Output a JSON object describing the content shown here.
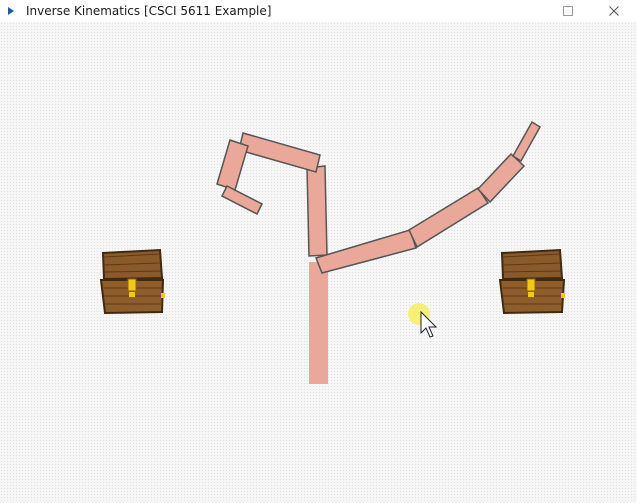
{
  "window": {
    "title": "Inverse Kinematics [CSCI 5611 Example]",
    "icon": "app-icon",
    "controls": [
      "maximize-icon",
      "close-icon"
    ]
  },
  "colors": {
    "limb_fill": "#eaa89a",
    "limb_stroke": "#555555",
    "chest_wood": "#8b5a2b",
    "chest_dark": "#4a3214",
    "lock_gold": "#f2c81a",
    "goal": "#f4ef6a"
  },
  "scene": {
    "cursor_icon": "mouse-pointer-icon",
    "goal_marker": "ik-goal-circle",
    "chests": [
      "treasure-chest-left",
      "treasure-chest-right"
    ]
  }
}
